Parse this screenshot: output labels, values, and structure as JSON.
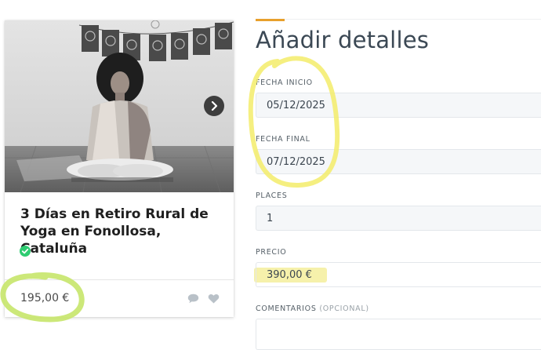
{
  "listing": {
    "title": "3 Días en Retiro Rural de Yoga en Fonollosa, Cataluña",
    "price": "195,00 €"
  },
  "form": {
    "title": "Añadir detalles",
    "fields": [
      {
        "label": "FECHA INICIO",
        "value": "05/12/2025"
      },
      {
        "label": "FECHA FINAL",
        "value": "07/12/2025"
      },
      {
        "label": "PLACES",
        "value": "1"
      },
      {
        "label": "PRECIO",
        "value": "390,00 €"
      },
      {
        "label": "COMENTARIOS",
        "optional": "(OPCIONAL)",
        "value": ""
      }
    ]
  },
  "colors": {
    "accent": "#e8a02c",
    "verified": "#2ecc71",
    "annotation_yellow": "#f3ec6a",
    "annotation_green": "#c7e56a"
  }
}
